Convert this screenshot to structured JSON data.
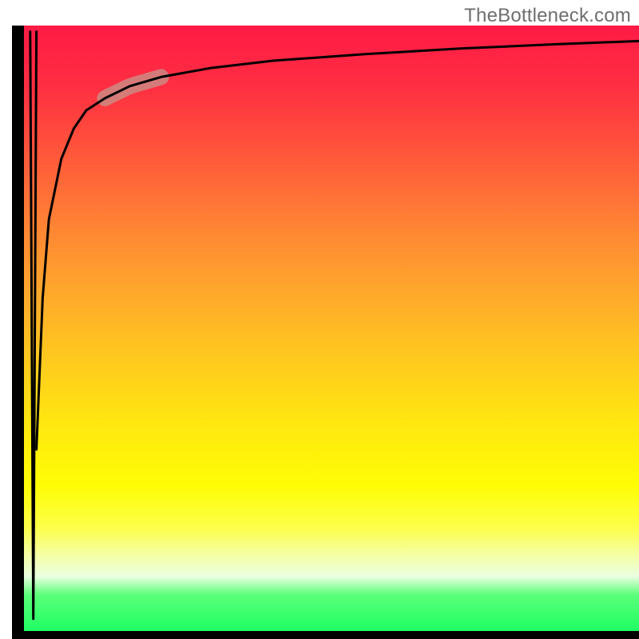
{
  "watermark": {
    "text": "TheBottleneck.com"
  },
  "chart_data": {
    "type": "line",
    "title": "",
    "xlabel": "",
    "ylabel": "",
    "xlim": [
      0,
      100
    ],
    "ylim": [
      0,
      100
    ],
    "grid": false,
    "legend": false,
    "background_gradient": {
      "direction": "vertical",
      "stops": [
        {
          "pos": 0.0,
          "color": "#ff1a45"
        },
        {
          "pos": 0.5,
          "color": "#ffd21a"
        },
        {
          "pos": 0.8,
          "color": "#ffff40"
        },
        {
          "pos": 1.0,
          "color": "#1fff63"
        }
      ]
    },
    "series": [
      {
        "name": "spike",
        "description": "brief vertical down-up spike very close to x=0",
        "x": [
          1.0,
          1.5,
          2.0
        ],
        "y": [
          99,
          2,
          99
        ]
      },
      {
        "name": "curve",
        "description": "steep-rise-then-plateau function (logarithm-like)",
        "x": [
          2,
          3,
          4,
          6,
          8,
          10,
          13,
          17,
          22,
          30,
          40,
          55,
          70,
          85,
          100
        ],
        "y": [
          30,
          55,
          68,
          78,
          83,
          86,
          88,
          90,
          91.5,
          93,
          94.2,
          95.3,
          96.2,
          96.9,
          97.5
        ]
      }
    ],
    "marker": {
      "description": "highlighted segment on the curve",
      "x_range": [
        13,
        22
      ],
      "color": "#cc8a82"
    }
  }
}
